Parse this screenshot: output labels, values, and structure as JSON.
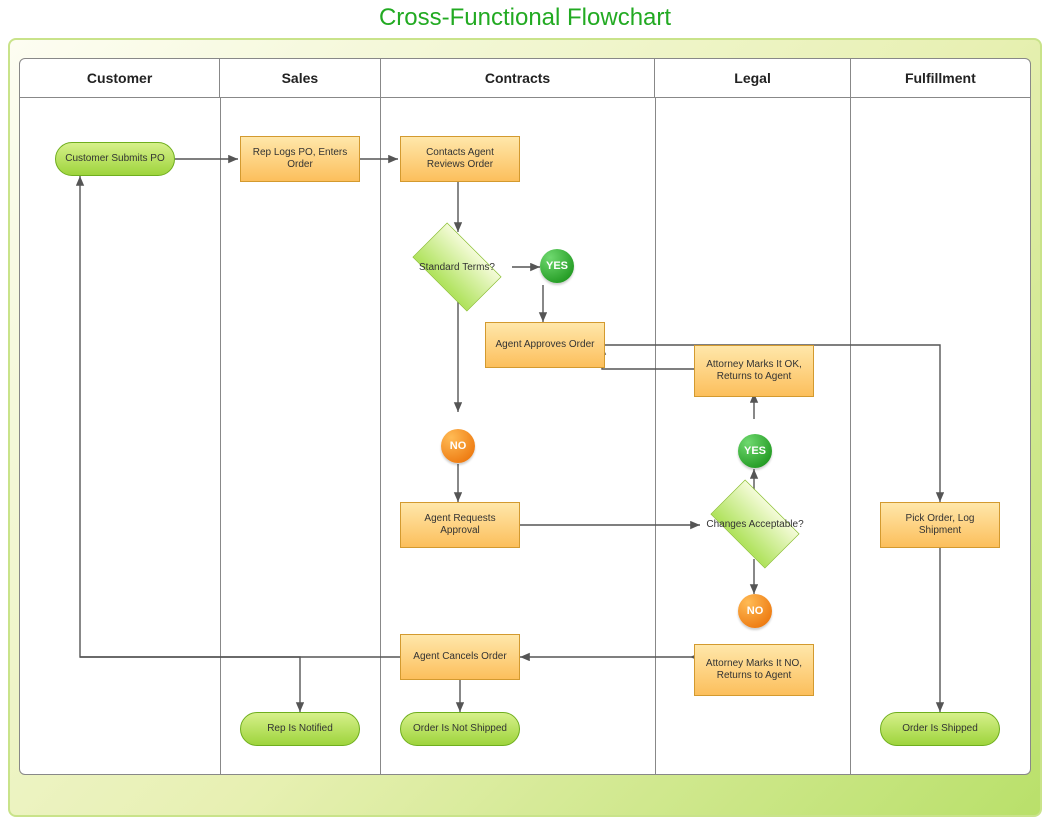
{
  "title": "Cross-Functional Flowchart",
  "lanes": {
    "customer": "Customer",
    "sales": "Sales",
    "contracts": "Contracts",
    "legal": "Legal",
    "fulfillment": "Fulfillment"
  },
  "nodes": {
    "customer_submit": "Customer Submits PO",
    "rep_logs": "Rep Logs PO, Enters Order",
    "agent_reviews": "Contacts Agent Reviews Order",
    "standard_terms": "Standard Terms?",
    "agent_approves": "Agent Approves Order",
    "agent_requests": "Agent Requests Approval",
    "agent_cancels": "Agent Cancels Order",
    "changes_acceptable": "Changes Acceptable?",
    "attorney_ok": "Attorney Marks It OK, Returns to Agent",
    "attorney_no": "Attorney Marks It NO, Returns to Agent",
    "pick_order": "Pick Order, Log Shipment",
    "rep_notified": "Rep Is Notified",
    "not_shipped": "Order Is Not Shipped",
    "shipped": "Order Is Shipped"
  },
  "labels": {
    "yes": "YES",
    "no": "NO"
  }
}
